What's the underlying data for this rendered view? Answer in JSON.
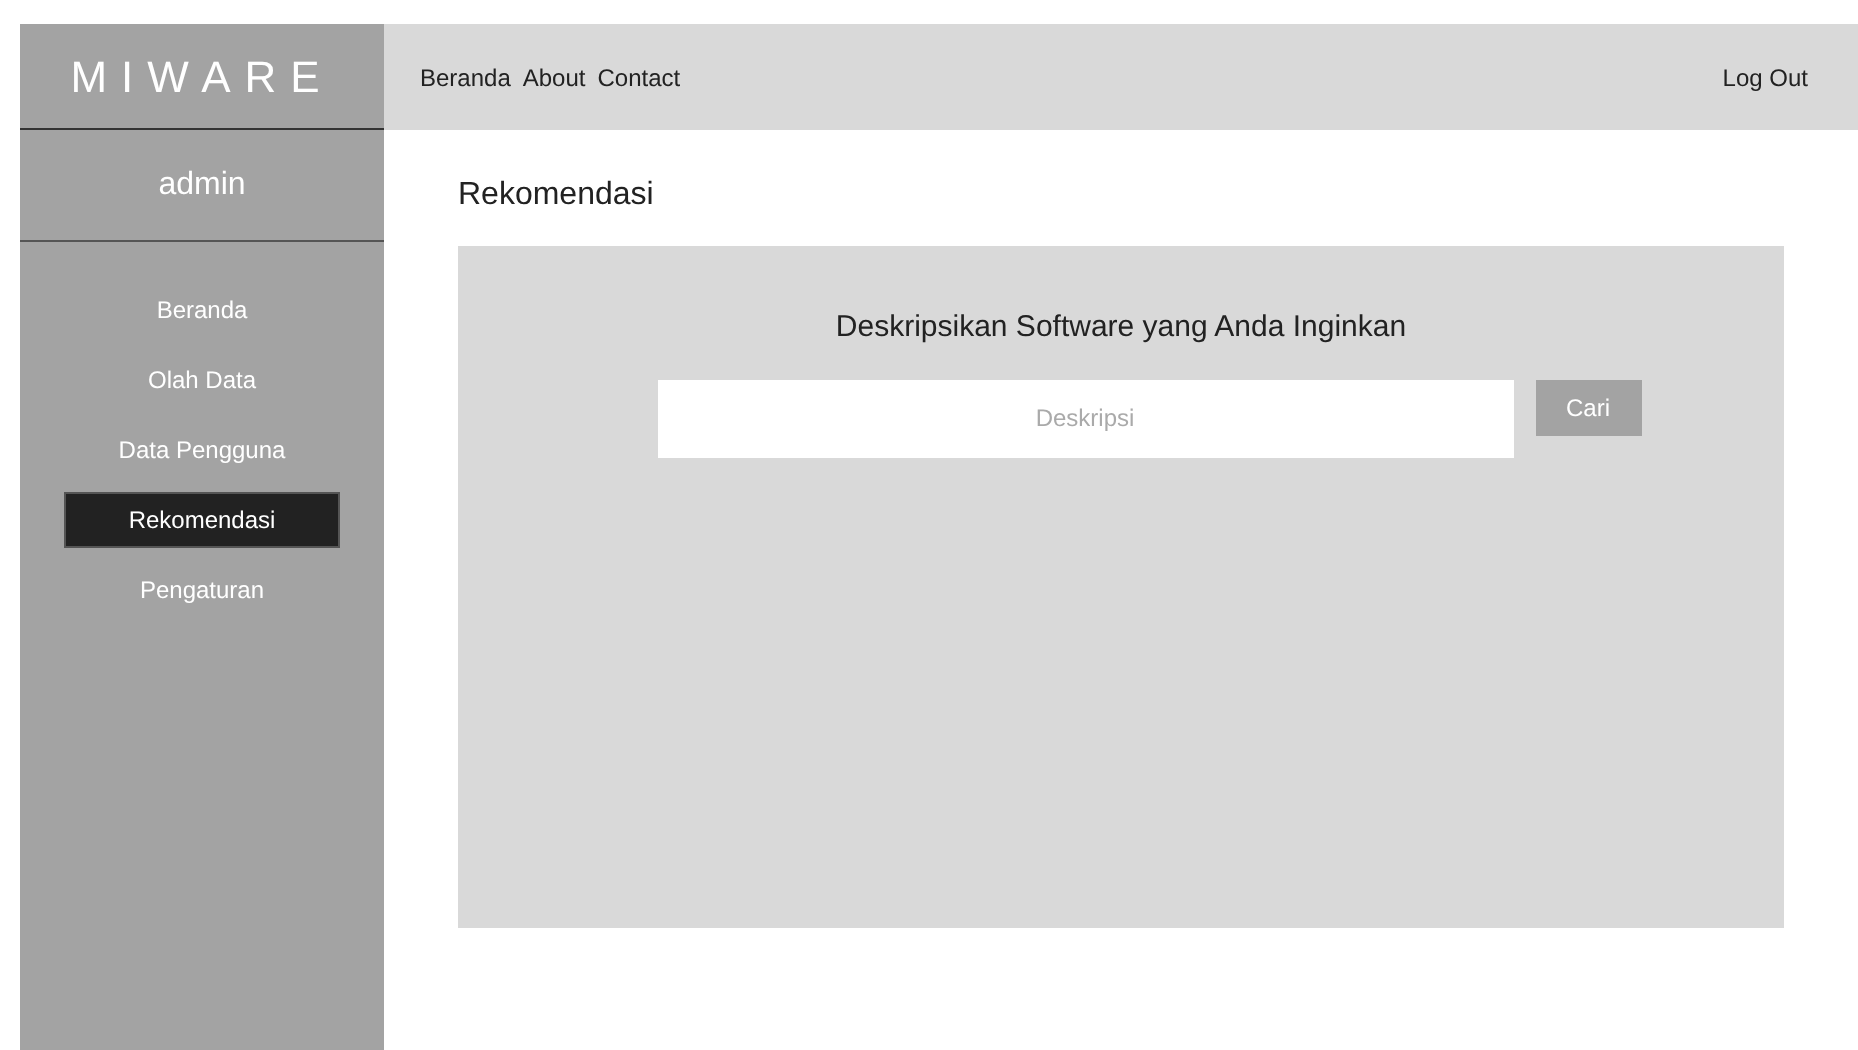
{
  "sidebar": {
    "logo": "MIWARE",
    "user": "admin",
    "items": [
      {
        "label": "Beranda",
        "selected": false
      },
      {
        "label": "Olah Data",
        "selected": false
      },
      {
        "label": "Data Pengguna",
        "selected": false
      },
      {
        "label": "Rekomendasi",
        "selected": true
      },
      {
        "label": "Pengaturan",
        "selected": false
      }
    ]
  },
  "top_nav": {
    "links": [
      "Beranda",
      "About",
      "Contact"
    ],
    "logout": "Log Out"
  },
  "page_title": "Rekomendasi",
  "search_panel": {
    "heading": "Deskripsikan Software yang Anda Inginkan",
    "placeholder": "Deskripsi",
    "button": "Cari"
  }
}
